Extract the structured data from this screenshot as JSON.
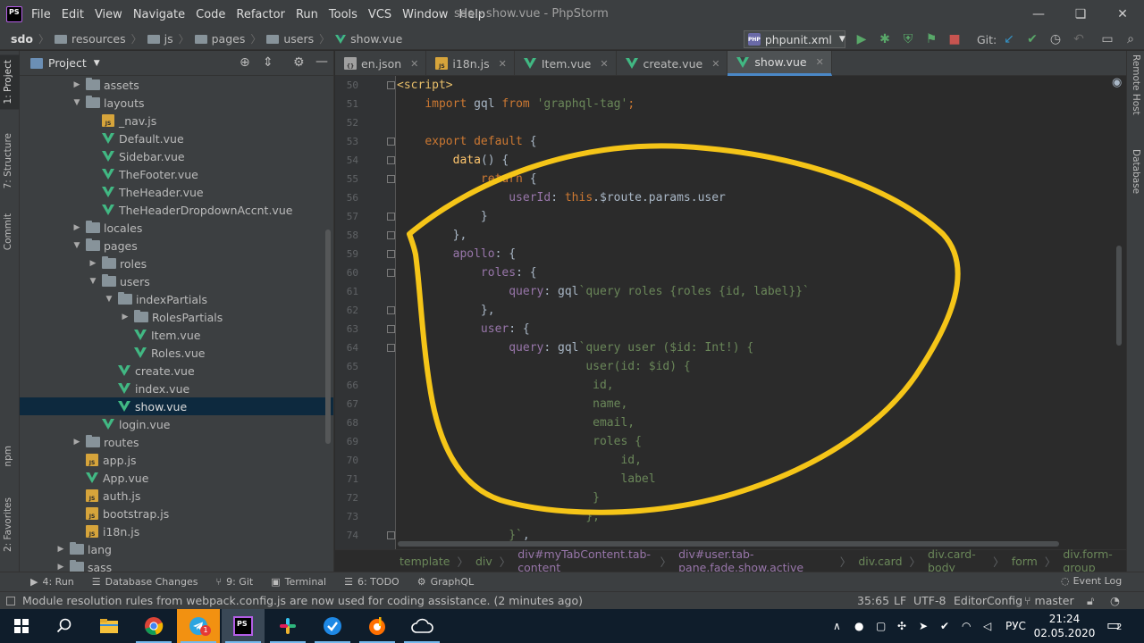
{
  "app": {
    "icon_label": "PS",
    "window_title": "sdo - show.vue - PhpStorm",
    "menu": [
      "File",
      "Edit",
      "View",
      "Navigate",
      "Code",
      "Refactor",
      "Run",
      "Tools",
      "VCS",
      "Window",
      "Help"
    ]
  },
  "navbar": {
    "breadcrumb": [
      "sdo",
      "resources",
      "js",
      "pages",
      "users",
      "show.vue"
    ],
    "run_config": "phpunit.xml",
    "run_config_badge": "PHP",
    "git_label": "Git:"
  },
  "left_strip": [
    "1: Project",
    "7: Structure",
    "Commit",
    "npm",
    "2: Favorites"
  ],
  "right_strip": [
    "Remote Host",
    "Database"
  ],
  "project": {
    "title": "Project",
    "tree": [
      {
        "label": "assets",
        "type": "folder",
        "depth": 3,
        "arrow": "▶"
      },
      {
        "label": "layouts",
        "type": "folder",
        "depth": 3,
        "arrow": "▼"
      },
      {
        "label": "_nav.js",
        "type": "js",
        "depth": 4,
        "arrow": ""
      },
      {
        "label": "Default.vue",
        "type": "vue",
        "depth": 4,
        "arrow": ""
      },
      {
        "label": "Sidebar.vue",
        "type": "vue",
        "depth": 4,
        "arrow": ""
      },
      {
        "label": "TheFooter.vue",
        "type": "vue",
        "depth": 4,
        "arrow": ""
      },
      {
        "label": "TheHeader.vue",
        "type": "vue",
        "depth": 4,
        "arrow": ""
      },
      {
        "label": "TheHeaderDropdownAccnt.vue",
        "type": "vue",
        "depth": 4,
        "arrow": ""
      },
      {
        "label": "locales",
        "type": "folder",
        "depth": 3,
        "arrow": "▶"
      },
      {
        "label": "pages",
        "type": "folder",
        "depth": 3,
        "arrow": "▼"
      },
      {
        "label": "roles",
        "type": "folder",
        "depth": 4,
        "arrow": "▶"
      },
      {
        "label": "users",
        "type": "folder",
        "depth": 4,
        "arrow": "▼"
      },
      {
        "label": "indexPartials",
        "type": "folder",
        "depth": 5,
        "arrow": "▼"
      },
      {
        "label": "RolesPartials",
        "type": "folder",
        "depth": 6,
        "arrow": "▶"
      },
      {
        "label": "Item.vue",
        "type": "vue",
        "depth": 6,
        "arrow": ""
      },
      {
        "label": "Roles.vue",
        "type": "vue",
        "depth": 6,
        "arrow": ""
      },
      {
        "label": "create.vue",
        "type": "vue",
        "depth": 5,
        "arrow": ""
      },
      {
        "label": "index.vue",
        "type": "vue",
        "depth": 5,
        "arrow": ""
      },
      {
        "label": "show.vue",
        "type": "vue",
        "depth": 5,
        "arrow": "",
        "selected": true
      },
      {
        "label": "login.vue",
        "type": "vue",
        "depth": 4,
        "arrow": ""
      },
      {
        "label": "routes",
        "type": "folder",
        "depth": 3,
        "arrow": "▶"
      },
      {
        "label": "app.js",
        "type": "js",
        "depth": 3,
        "arrow": ""
      },
      {
        "label": "App.vue",
        "type": "vue",
        "depth": 3,
        "arrow": ""
      },
      {
        "label": "auth.js",
        "type": "js",
        "depth": 3,
        "arrow": ""
      },
      {
        "label": "bootstrap.js",
        "type": "js",
        "depth": 3,
        "arrow": ""
      },
      {
        "label": "i18n.js",
        "type": "js",
        "depth": 3,
        "arrow": ""
      },
      {
        "label": "lang",
        "type": "folder",
        "depth": 2,
        "arrow": "▶"
      },
      {
        "label": "sass",
        "type": "folder",
        "depth": 2,
        "arrow": "▶"
      }
    ]
  },
  "tabs": [
    {
      "label": "en.json",
      "type": "json",
      "active": false
    },
    {
      "label": "i18n.js",
      "type": "js",
      "active": false
    },
    {
      "label": "Item.vue",
      "type": "vue",
      "active": false
    },
    {
      "label": "create.vue",
      "type": "vue",
      "active": false
    },
    {
      "label": "show.vue",
      "type": "vue",
      "active": true
    }
  ],
  "code": [
    {
      "n": "50",
      "fold": true,
      "tokens": [
        [
          "tag",
          "<script>"
        ]
      ]
    },
    {
      "n": "51",
      "fold": false,
      "tokens": [
        [
          "plain",
          "    "
        ],
        [
          "kw",
          "import "
        ],
        [
          "plain",
          "gql "
        ],
        [
          "kw",
          "from "
        ],
        [
          "str",
          "'graphql-tag'"
        ],
        [
          "kw",
          ";"
        ]
      ]
    },
    {
      "n": "52",
      "fold": false,
      "tokens": []
    },
    {
      "n": "53",
      "fold": true,
      "tokens": [
        [
          "plain",
          "    "
        ],
        [
          "kw",
          "export default "
        ],
        [
          "plain",
          "{"
        ]
      ]
    },
    {
      "n": "54",
      "fold": true,
      "tokens": [
        [
          "plain",
          "        "
        ],
        [
          "fn",
          "data"
        ],
        [
          "plain",
          "() {"
        ]
      ]
    },
    {
      "n": "55",
      "fold": true,
      "tokens": [
        [
          "plain",
          "            "
        ],
        [
          "kw",
          "return "
        ],
        [
          "plain",
          "{"
        ]
      ]
    },
    {
      "n": "56",
      "fold": false,
      "tokens": [
        [
          "plain",
          "                "
        ],
        [
          "prop",
          "userId"
        ],
        [
          "plain",
          ": "
        ],
        [
          "kw",
          "this"
        ],
        [
          "plain",
          ".$route.params.user"
        ]
      ]
    },
    {
      "n": "57",
      "fold": true,
      "tokens": [
        [
          "plain",
          "            }"
        ]
      ]
    },
    {
      "n": "58",
      "fold": true,
      "tokens": [
        [
          "plain",
          "        },"
        ]
      ]
    },
    {
      "n": "59",
      "fold": true,
      "tokens": [
        [
          "plain",
          "        "
        ],
        [
          "prop",
          "apollo"
        ],
        [
          "plain",
          ": {"
        ]
      ]
    },
    {
      "n": "60",
      "fold": true,
      "tokens": [
        [
          "plain",
          "            "
        ],
        [
          "prop",
          "roles"
        ],
        [
          "plain",
          ": {"
        ]
      ]
    },
    {
      "n": "61",
      "fold": false,
      "tokens": [
        [
          "plain",
          "                "
        ],
        [
          "prop",
          "query"
        ],
        [
          "plain",
          ": gql"
        ],
        [
          "str",
          "`query roles {roles {id, label}}`"
        ]
      ]
    },
    {
      "n": "62",
      "fold": true,
      "tokens": [
        [
          "plain",
          "            },"
        ]
      ]
    },
    {
      "n": "63",
      "fold": true,
      "tokens": [
        [
          "plain",
          "            "
        ],
        [
          "prop",
          "user"
        ],
        [
          "plain",
          ": {"
        ]
      ]
    },
    {
      "n": "64",
      "fold": true,
      "tokens": [
        [
          "plain",
          "                "
        ],
        [
          "prop",
          "query"
        ],
        [
          "plain",
          ": gql"
        ],
        [
          "str",
          "`query user ($id: Int!) {"
        ]
      ]
    },
    {
      "n": "65",
      "fold": false,
      "tokens": [
        [
          "str",
          "                           user(id: $id) {"
        ]
      ]
    },
    {
      "n": "66",
      "fold": false,
      "tokens": [
        [
          "str",
          "                            id,"
        ]
      ]
    },
    {
      "n": "67",
      "fold": false,
      "tokens": [
        [
          "str",
          "                            name,"
        ]
      ]
    },
    {
      "n": "68",
      "fold": false,
      "tokens": [
        [
          "str",
          "                            email,"
        ]
      ]
    },
    {
      "n": "69",
      "fold": false,
      "tokens": [
        [
          "str",
          "                            roles {"
        ]
      ]
    },
    {
      "n": "70",
      "fold": false,
      "tokens": [
        [
          "str",
          "                                id,"
        ]
      ]
    },
    {
      "n": "71",
      "fold": false,
      "tokens": [
        [
          "str",
          "                                label"
        ]
      ]
    },
    {
      "n": "72",
      "fold": false,
      "tokens": [
        [
          "str",
          "                            }"
        ]
      ]
    },
    {
      "n": "73",
      "fold": false,
      "tokens": [
        [
          "str",
          "                           },"
        ]
      ]
    },
    {
      "n": "74",
      "fold": true,
      "tokens": [
        [
          "str",
          "                }`"
        ],
        [
          "plain",
          ","
        ]
      ]
    }
  ],
  "html_path": [
    {
      "label": "template",
      "accent": false
    },
    {
      "label": "div",
      "accent": false
    },
    {
      "label": "div#myTabContent.tab-content",
      "accent": true
    },
    {
      "label": "div#user.tab-pane.fade.show.active",
      "accent": true
    },
    {
      "label": "div.card",
      "accent": false
    },
    {
      "label": "div.card-body",
      "accent": false
    },
    {
      "label": "form",
      "accent": false
    },
    {
      "label": "div.form-group",
      "accent": false
    }
  ],
  "tool_buttons": [
    {
      "label": "4: Run",
      "icon": "▶"
    },
    {
      "label": "Database Changes",
      "icon": "☰"
    },
    {
      "label": "9: Git",
      "icon": "⑂"
    },
    {
      "label": "Terminal",
      "icon": "▣"
    },
    {
      "label": "6: TODO",
      "icon": "☰"
    },
    {
      "label": "GraphQL",
      "icon": "⚙"
    }
  ],
  "event_log": "Event Log",
  "status": {
    "message": "Module resolution rules from webpack.config.js are now used for coding assistance. (2 minutes ago)",
    "position": "35:65",
    "line_sep": "LF",
    "encoding": "UTF-8",
    "editor_config": "EditorConfig",
    "branch": "master"
  },
  "taskbar": {
    "telegram_badge": "1",
    "tray_lang": "РУС",
    "time": "21:24",
    "date": "02.05.2020",
    "notifications": "2"
  },
  "colors": {
    "annotation": "#f5c518",
    "vue_green": "#41b883",
    "accent_blue": "#4a88c7"
  }
}
